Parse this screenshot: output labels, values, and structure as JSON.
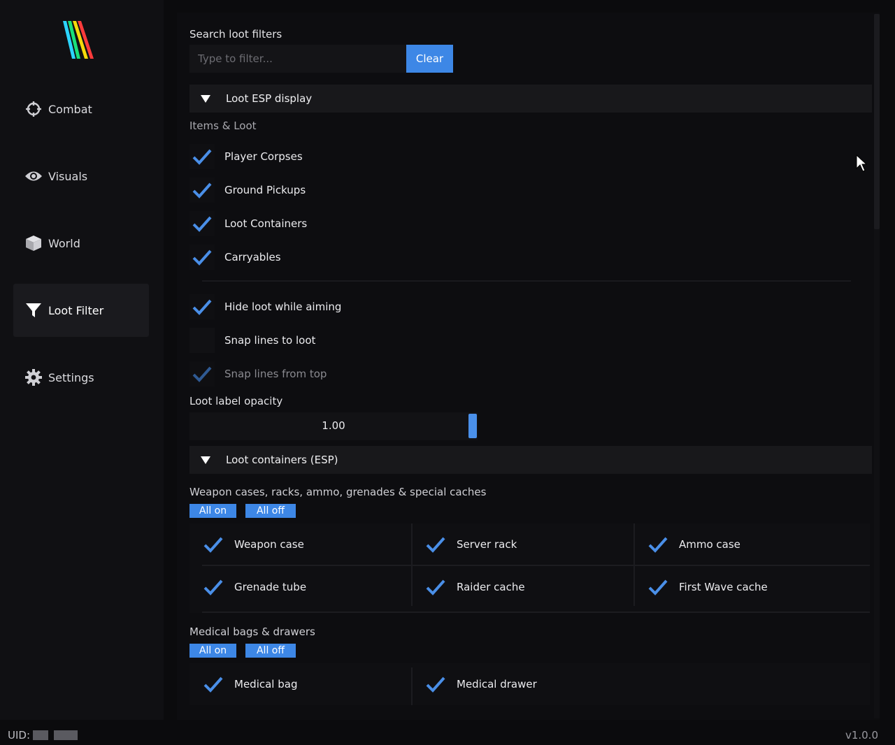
{
  "sidebar": {
    "items": [
      {
        "label": "Combat",
        "icon": "crosshair-icon",
        "active": false
      },
      {
        "label": "Visuals",
        "icon": "eye-icon",
        "active": false
      },
      {
        "label": "World",
        "icon": "cube-icon",
        "active": false
      },
      {
        "label": "Loot Filter",
        "icon": "funnel-icon",
        "active": true
      },
      {
        "label": "Settings",
        "icon": "gear-icon",
        "active": false
      }
    ]
  },
  "search": {
    "label": "Search loot filters",
    "placeholder": "Type to filter...",
    "value": "",
    "clear_label": "Clear"
  },
  "loot_esp": {
    "header": "Loot ESP display",
    "expanded": true,
    "subheading": "Items & Loot",
    "items": [
      {
        "label": "Player Corpses",
        "checked": true
      },
      {
        "label": "Ground Pickups",
        "checked": true
      },
      {
        "label": "Loot Containers",
        "checked": true
      },
      {
        "label": "Carryables",
        "checked": true
      }
    ],
    "options": [
      {
        "label": "Hide loot while aiming",
        "checked": true,
        "disabled": false
      },
      {
        "label": "Snap lines to loot",
        "checked": false,
        "disabled": false
      },
      {
        "label": "Snap lines from top",
        "checked": true,
        "disabled": true
      }
    ],
    "opacity_label": "Loot label opacity",
    "opacity_value": "1.00",
    "opacity_fraction": 1.0
  },
  "loot_containers": {
    "header": "Loot containers (ESP)",
    "expanded": true,
    "groups": [
      {
        "title": "Weapon cases, racks, ammo, grenades & special caches",
        "all_on": "All on",
        "all_off": "All off",
        "items": [
          {
            "label": "Weapon case",
            "checked": true
          },
          {
            "label": "Server rack",
            "checked": true
          },
          {
            "label": "Ammo case",
            "checked": true
          },
          {
            "label": "Grenade tube",
            "checked": true
          },
          {
            "label": "Raider cache",
            "checked": true
          },
          {
            "label": "First Wave cache",
            "checked": true
          }
        ]
      },
      {
        "title": "Medical bags & drawers",
        "all_on": "All on",
        "all_off": "All off",
        "items": [
          {
            "label": "Medical bag",
            "checked": true
          },
          {
            "label": "Medical drawer",
            "checked": true
          }
        ]
      }
    ]
  },
  "footer": {
    "uid_label": "UID:",
    "version": "v1.0.0"
  },
  "colors": {
    "accent": "#3d87e6",
    "check": "#4a8fe8",
    "background": "#0b0b0d"
  }
}
